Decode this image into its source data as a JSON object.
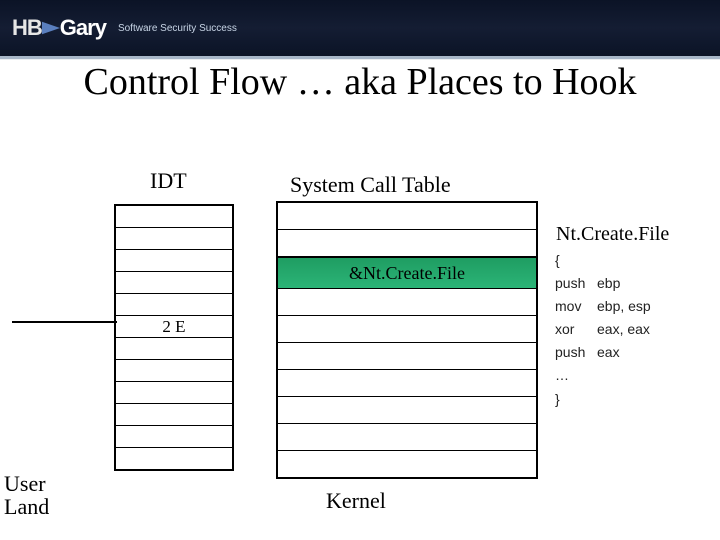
{
  "logo": {
    "hb": "HB",
    "gary": "Gary",
    "tagline": "Software Security Success"
  },
  "title": "Control Flow … aka Places to Hook",
  "labels": {
    "idt": "IDT",
    "sct": "System Call Table",
    "func": "Nt.Create.File",
    "userland_line1": "User",
    "userland_line2": "Land",
    "kernel": "Kernel"
  },
  "idt_rows": [
    "",
    "",
    "",
    "",
    "",
    "2 E",
    "",
    "",
    "",
    "",
    "",
    ""
  ],
  "sct_rows": [
    "",
    "",
    "&Nt.Create.File",
    "",
    "",
    "",
    "",
    "",
    "",
    ""
  ],
  "sct_highlight_index": 2,
  "asm": [
    {
      "op": "{",
      "arg": ""
    },
    {
      "op": "push",
      "arg": "ebp"
    },
    {
      "op": "mov",
      "arg": "ebp, esp"
    },
    {
      "op": "xor",
      "arg": "eax, eax"
    },
    {
      "op": "push",
      "arg": "eax"
    },
    {
      "op": "…",
      "arg": ""
    },
    {
      "op": "}",
      "arg": ""
    }
  ]
}
